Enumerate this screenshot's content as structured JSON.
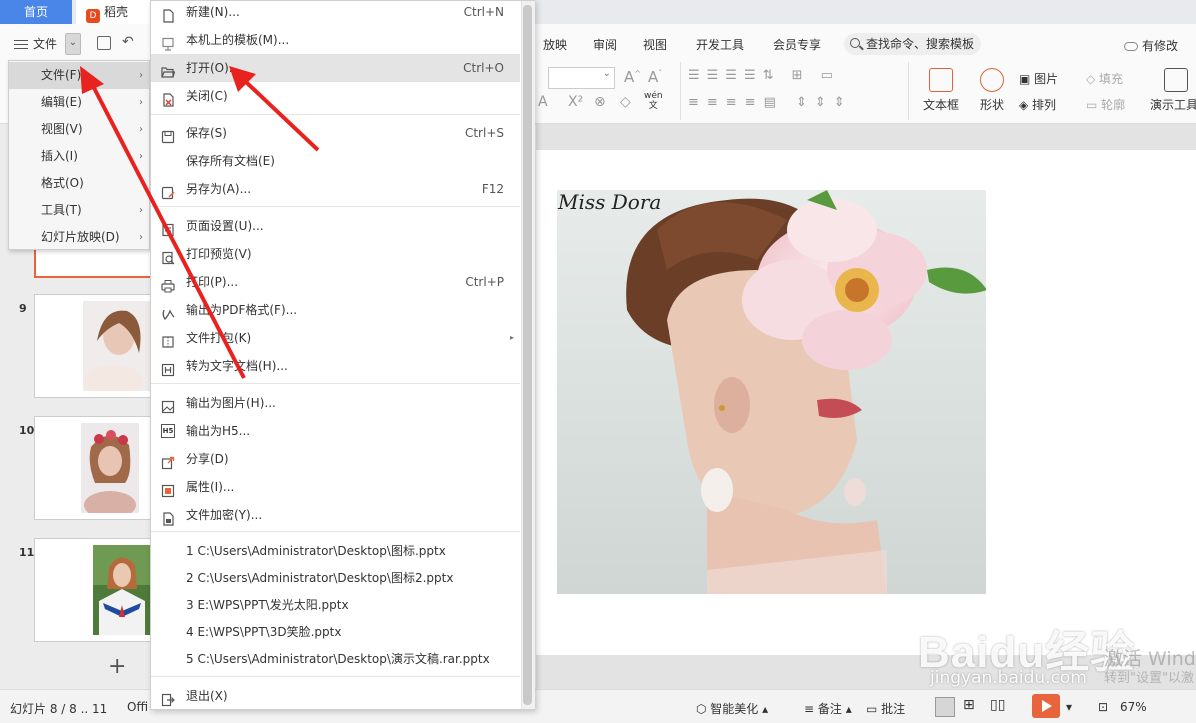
{
  "tabs": {
    "home": "首页",
    "daoke": "稻壳"
  },
  "ribbon": {
    "file_label": "文件",
    "tabs": [
      "放映",
      "审阅",
      "视图",
      "开发工具",
      "会员专享"
    ],
    "search_placeholder": "查找命令、搜索模板",
    "changes": "有修改",
    "tools": {
      "text_box": "文本框",
      "shape": "形状",
      "picture": "图片",
      "fill": "填充",
      "arrange": "排列",
      "outline": "轮廓",
      "present": "演示工具",
      "wen_glyph": "wén\n文"
    }
  },
  "file_submenu": [
    {
      "label": "文件(F)",
      "arrow": "›"
    },
    {
      "label": "编辑(E)",
      "arrow": "›"
    },
    {
      "label": "视图(V)",
      "arrow": "›"
    },
    {
      "label": "插入(I)",
      "arrow": "›"
    },
    {
      "label": "格式(O)",
      "arrow": ""
    },
    {
      "label": "工具(T)",
      "arrow": "›"
    },
    {
      "label": "幻灯片放映(D)",
      "arrow": "›"
    }
  ],
  "file_menu": [
    {
      "icon": "new-doc-icon",
      "label": "新建(N)...",
      "shortcut": "Ctrl+N"
    },
    {
      "icon": "template-icon",
      "label": "本机上的模板(M)...",
      "shortcut": ""
    },
    {
      "icon": "folder-open-icon",
      "label": "打开(O)...",
      "shortcut": "Ctrl+O"
    },
    {
      "icon": "close-doc-icon",
      "label": "关闭(C)",
      "shortcut": ""
    },
    {
      "icon": "save-icon",
      "label": "保存(S)",
      "shortcut": "Ctrl+S"
    },
    {
      "icon": "",
      "label": "保存所有文档(E)",
      "shortcut": ""
    },
    {
      "icon": "save-as-icon",
      "label": "另存为(A)...",
      "shortcut": "F12"
    },
    {
      "icon": "page-setup-icon",
      "label": "页面设置(U)...",
      "shortcut": ""
    },
    {
      "icon": "print-preview-icon",
      "label": "打印预览(V)",
      "shortcut": ""
    },
    {
      "icon": "print-icon",
      "label": "打印(P)...",
      "shortcut": "Ctrl+P"
    },
    {
      "icon": "pdf-icon",
      "label": "输出为PDF格式(F)...",
      "shortcut": ""
    },
    {
      "icon": "package-icon",
      "label": "文件打包(K)",
      "shortcut": ""
    },
    {
      "icon": "to-text-icon",
      "label": "转为文字文档(H)...",
      "shortcut": ""
    },
    {
      "icon": "export-image-icon",
      "label": "输出为图片(H)...",
      "shortcut": ""
    },
    {
      "icon": "h5-icon",
      "label": "输出为H5...",
      "shortcut": ""
    },
    {
      "icon": "share-icon",
      "label": "分享(D)",
      "shortcut": ""
    },
    {
      "icon": "properties-icon",
      "label": "属性(I)...",
      "shortcut": ""
    },
    {
      "icon": "encrypt-icon",
      "label": "文件加密(Y)...",
      "shortcut": ""
    },
    {
      "icon": "exit-icon",
      "label": "退出(X)",
      "shortcut": ""
    }
  ],
  "h5_icon_text": "H5",
  "recent_files": [
    "1 C:\\Users\\Administrator\\Desktop\\图标.pptx",
    "2 C:\\Users\\Administrator\\Desktop\\图标2.pptx",
    "3 E:\\WPS\\PPT\\发光太阳.pptx",
    "4 E:\\WPS\\PPT\\3D笑脸.pptx",
    "5 C:\\Users\\Administrator\\Desktop\\演示文稿.rar.pptx"
  ],
  "slides_panel": {
    "numbers": [
      "9",
      "10",
      "11"
    ],
    "add": "+"
  },
  "slide": {
    "caption": "Miss Dora"
  },
  "status": {
    "slide_info": "幻灯片 8 / 8 .. 11",
    "theme": "Offi",
    "beautify": "智能美化",
    "notes": "备注",
    "comments": "批注",
    "zoom": "67%"
  },
  "watermark": {
    "brand": "Baidu经验",
    "url": "jingyan.baidu.com",
    "activate": "激活 Wind",
    "activate_hint": "转到\"设置\"以激"
  },
  "colors": {
    "accent": "#4a86e8",
    "brand": "#e8643c",
    "annotation": "#e8231f"
  }
}
